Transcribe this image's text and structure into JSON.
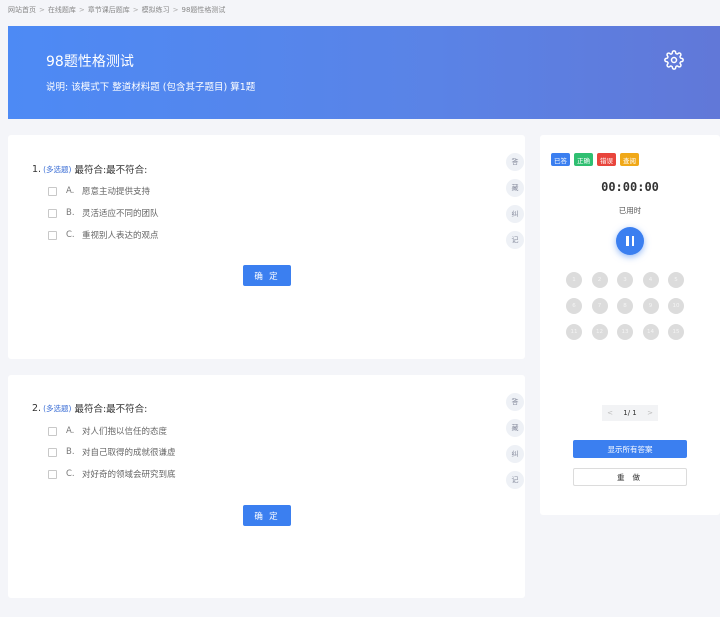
{
  "breadcrumb": [
    "网站首页",
    "在线题库",
    "章节课后题库",
    "模拟练习",
    "98题性格测试"
  ],
  "banner": {
    "title": "98题性格测试",
    "description": "说明:   该模式下 整道材料题 (包含其子题目) 算1题",
    "settings_icon": "gear-icon"
  },
  "questions": [
    {
      "number": "1.",
      "type_tag": "(多选题)",
      "stem": "最符合:最不符合:",
      "options": [
        {
          "letter": "A.",
          "text": "愿意主动提供支持"
        },
        {
          "letter": "B.",
          "text": "灵活适应不同的团队"
        },
        {
          "letter": "C.",
          "text": "重视别人表达的观点"
        }
      ],
      "confirm_label": "确 定"
    },
    {
      "number": "2.",
      "type_tag": "(多选题)",
      "stem": "最符合:最不符合:",
      "options": [
        {
          "letter": "A.",
          "text": "对人们抱以信任的态度"
        },
        {
          "letter": "B.",
          "text": "对自己取得的成就很谦虚"
        },
        {
          "letter": "C.",
          "text": "对好奇的领域会研究到底"
        }
      ],
      "confirm_label": "确 定"
    }
  ],
  "side_tools": [
    "答",
    "藏",
    "纠",
    "记"
  ],
  "panel": {
    "legend": [
      {
        "label": "已答",
        "color": "#3b7ff0"
      },
      {
        "label": "正确",
        "color": "#2fbf71"
      },
      {
        "label": "错误",
        "color": "#e8453c"
      },
      {
        "label": "查阅",
        "color": "#f0a818"
      }
    ],
    "timer": "00:00:00",
    "timer_label": "已用时",
    "pause_icon": "pause-icon",
    "question_numbers": [
      "1",
      "2",
      "3",
      "4",
      "5",
      "6",
      "7",
      "8",
      "9",
      "10",
      "11",
      "12",
      "13",
      "14",
      "15"
    ],
    "pager": {
      "prev": "<",
      "page": "1/ 1",
      "next": ">"
    },
    "show_answers_label": "显示所有答案",
    "reset_label": "重 做"
  }
}
